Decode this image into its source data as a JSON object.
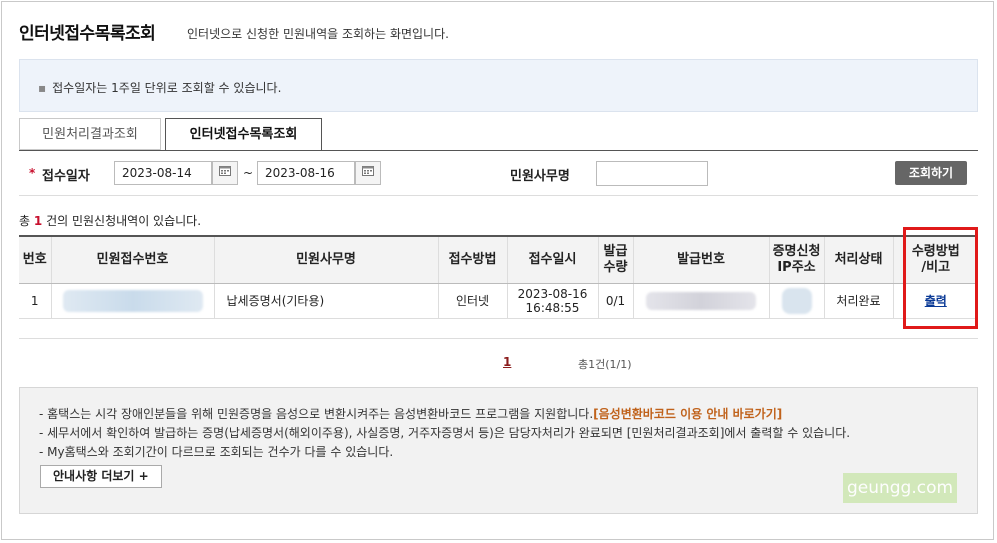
{
  "header": {
    "title": "인터넷접수목록조회",
    "description": "인터넷으로 신청한 민원내역을 조회하는 화면입니다."
  },
  "notice": {
    "bullet": "▪",
    "text": "접수일자는 1주일 단위로 조회할 수 있습니다."
  },
  "tabs": [
    {
      "label": "민원처리결과조회",
      "active": false
    },
    {
      "label": "인터넷접수목록조회",
      "active": true
    }
  ],
  "search": {
    "required_mark": "*",
    "date_label": "접수일자",
    "date_from": "2023-08-14",
    "date_to": "2023-08-16",
    "range_separator": "~",
    "office_label": "민원사무명",
    "office_value": "",
    "button_label": "조회하기",
    "calendar_icon": "calendar-icon"
  },
  "summary": {
    "prefix": "총",
    "count": "1",
    "suffix": "건의 민원신청내역이 있습니다."
  },
  "table": {
    "headers": [
      "번호",
      "민원접수번호",
      "민원사무명",
      "접수방법",
      "접수일시",
      "발급\n수량",
      "발급번호",
      "증명신청\nIP주소",
      "처리상태",
      "수령방법\n/비고"
    ],
    "rows": [
      {
        "no": "1",
        "receipt_no": "",
        "office_name": "납세증명서(기타용)",
        "method": "인터넷",
        "date": "2023-08-16",
        "time": "16:48:55",
        "quantity": "0/1",
        "issue_no": "",
        "ip": "",
        "status": "처리완료",
        "action": "출력"
      }
    ]
  },
  "pagination": {
    "current": "1",
    "total": "총1건(1/1)"
  },
  "info": {
    "line1_text": "- 홈택스는 시각 장애인분들을 위해 민원증명을 음성으로 변환시켜주는 음성변환바코드 프로그램을 지원합니다.",
    "line1_link": "[음성변환바코드 이용 안내 바로가기]",
    "line2": "- 세무서에서 확인하여 발급하는 증명(납세증명서(해외이주용), 사실증명, 거주자증명서 등)은 담당자처리가 완료되면 [민원처리결과조회]에서 출력할 수 있습니다.",
    "line3": "- My홈택스와 조회기간이 다르므로 조회되는 건수가 다를 수 있습니다.",
    "more_button": "안내사항 더보기 +"
  },
  "watermark": "geungg.com",
  "colors": {
    "accent_red": "#c8102e",
    "highlight_red": "#e01919",
    "link_blue": "#0b3a96",
    "link_orange": "#c0621b",
    "button_gray": "#666666"
  }
}
